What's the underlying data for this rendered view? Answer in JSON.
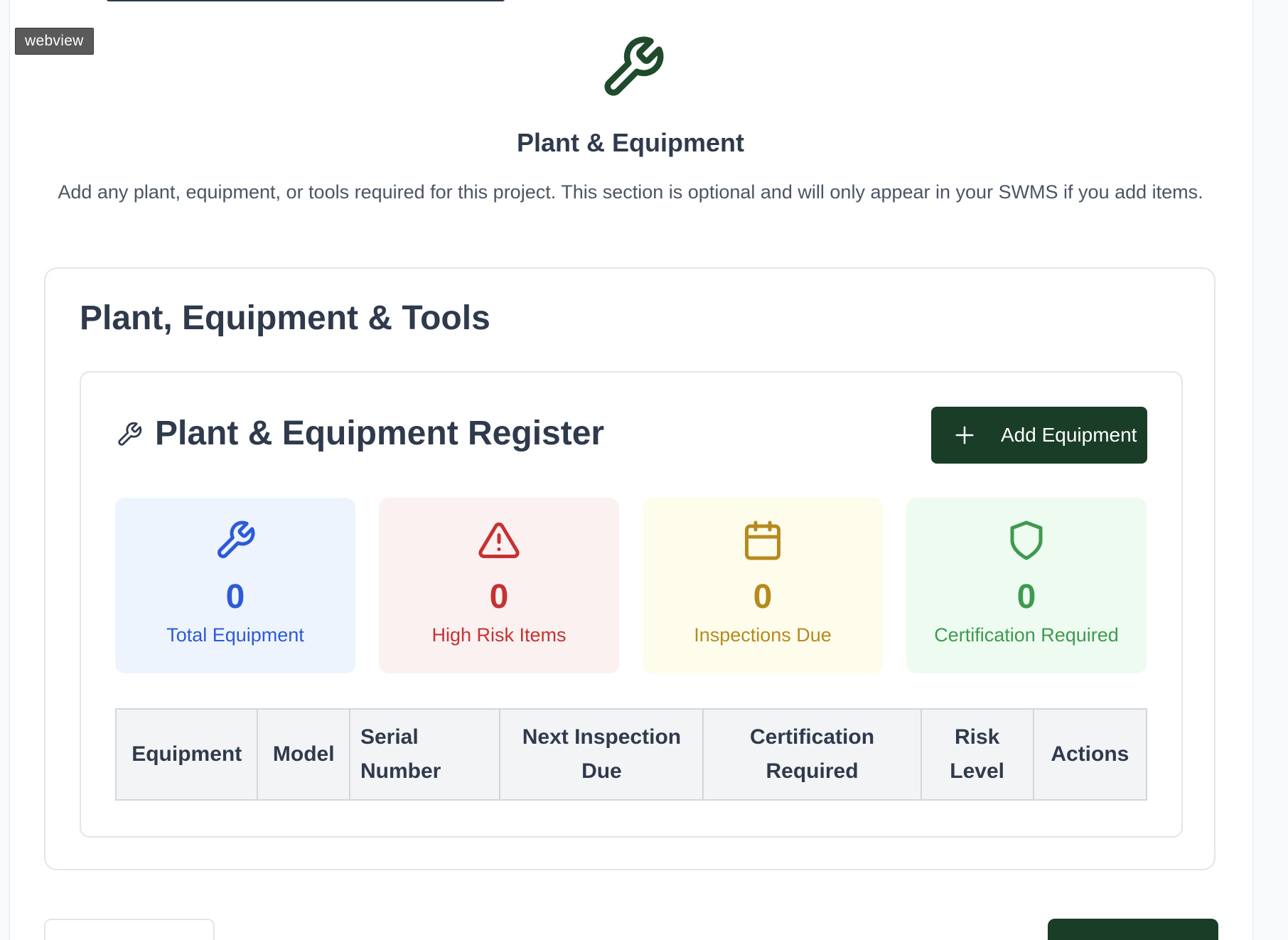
{
  "overlay": {
    "webview_label": "webview"
  },
  "hero": {
    "icon": "wrench-icon",
    "title": "Plant & Equipment",
    "description": "Add any plant, equipment, or tools required for this project. This section is optional and will only appear in your SWMS if you add items."
  },
  "section": {
    "title": "Plant, Equipment & Tools"
  },
  "register": {
    "icon": "wrench-icon",
    "title": "Plant & Equipment Register",
    "add_button_label": "Add Equipment",
    "add_button_icon": "plus-icon"
  },
  "stats": {
    "total": {
      "icon": "wrench-icon",
      "value": "0",
      "label": "Total Equipment",
      "color": "#2c5ad8"
    },
    "high_risk": {
      "icon": "warning-triangle-icon",
      "value": "0",
      "label": "High Risk Items",
      "color": "#c63131"
    },
    "inspections": {
      "icon": "calendar-icon",
      "value": "0",
      "label": "Inspections Due",
      "color": "#b68a1e"
    },
    "certification": {
      "icon": "shield-icon",
      "value": "0",
      "label": "Certification Required",
      "color": "#3f9a4f"
    }
  },
  "table": {
    "columns": [
      "Equipment",
      "Model",
      "Serial Number",
      "Next Inspection Due",
      "Certification Required",
      "Risk Level",
      "Actions"
    ]
  },
  "colors": {
    "primary": "#1a3d27",
    "heading": "#2f3b4c"
  }
}
